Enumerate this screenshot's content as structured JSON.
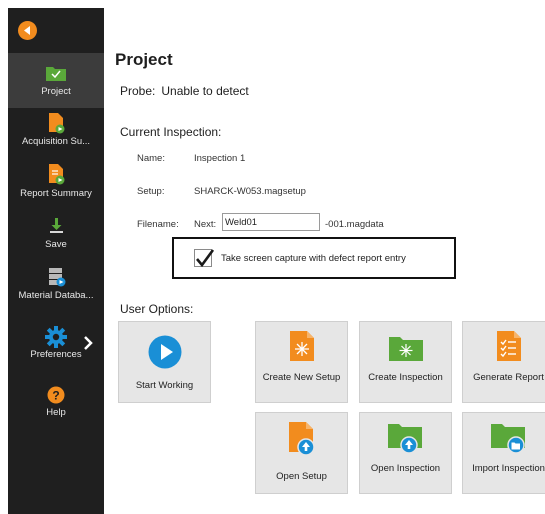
{
  "sidebar": {
    "items": [
      {
        "label": "Project",
        "icon": "folder-check-icon"
      },
      {
        "label": "Acquisition Su...",
        "icon": "document-play-icon"
      },
      {
        "label": "Report Summary",
        "icon": "report-play-icon"
      },
      {
        "label": "Save",
        "icon": "save-icon"
      },
      {
        "label": "Material Databa...",
        "icon": "database-icon"
      },
      {
        "label": "Preferences",
        "icon": "gear-icon"
      },
      {
        "label": "Help",
        "icon": "help-icon"
      }
    ]
  },
  "main": {
    "title": "Project",
    "probe_label": "Probe:",
    "probe_value": "Unable to detect",
    "current_inspection_heading": "Current Inspection:",
    "name_label": "Name:",
    "name_value": "Inspection 1",
    "setup_label": "Setup:",
    "setup_value": "SHARCK-W053.magsetup",
    "filename_label": "Filename:",
    "filename_next": "Next:",
    "filename_value": "Weld01",
    "filename_suffix": "-001.magdata",
    "capture_label": "Take screen capture with defect report entry",
    "capture_checked": true,
    "user_options_heading": "User Options:"
  },
  "tiles": {
    "start_working": "Start Working",
    "create_new_setup": "Create New Setup",
    "create_inspection": "Create Inspection",
    "generate_report": "Generate Report",
    "open_setup": "Open Setup",
    "open_inspection": "Open Inspection",
    "import_inspection": "Import Inspection"
  },
  "colors": {
    "sidebar_bg": "#1f1f1f",
    "accent_orange": "#f28c1e",
    "accent_green": "#5aa83a",
    "accent_blue": "#1a8fd6",
    "tile_bg": "#e6e6e6"
  }
}
